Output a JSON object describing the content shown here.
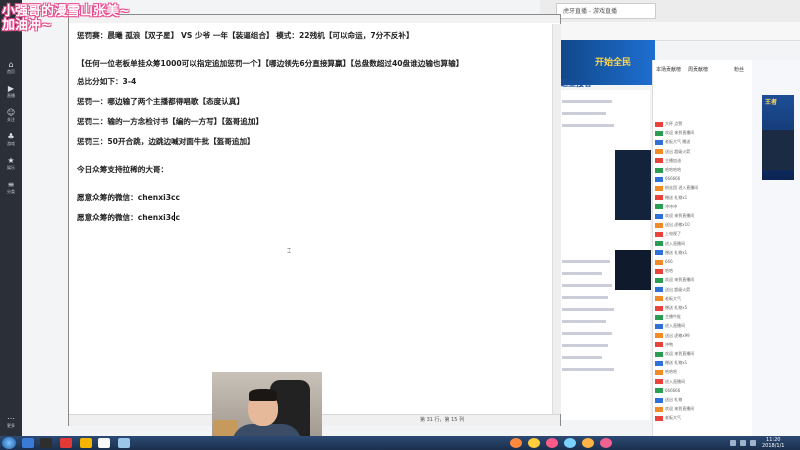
{
  "overlay": {
    "line1": "小强哥的漫雪山张美~",
    "line2": "加油冲~"
  },
  "sidebar": {
    "items": [
      {
        "icon": "home-icon",
        "label": "首页"
      },
      {
        "icon": "play-icon",
        "label": "直播"
      },
      {
        "icon": "user-icon",
        "label": "关注"
      },
      {
        "icon": "game-icon",
        "label": "游戏"
      },
      {
        "icon": "star-icon",
        "label": "娱乐"
      },
      {
        "icon": "list-icon",
        "label": "分类"
      },
      {
        "icon": "more-icon",
        "label": "更多"
      }
    ]
  },
  "notepad": {
    "lines": [
      "惩罚赛：晨曦 孤浪【双子星】 VS  少爷 一年【装逼组合】  模式：22残机【可以命运，7分不反补】",
      "【任何一位老板单挂众筹1000可以指定追加惩罚一个】【哪边领先6分直接算赢】【总盘数超过40盘谁边输也算输】",
      "总比分如下：3-4",
      "惩罚一：哪边输了两个主播都得唱歌【态度认真】",
      "惩罚二：输的一方念检讨书【编的一方写】【盔哥追加】",
      "惩罚三：50开合跳，边跳边喊对面牛批【盔哥追加】",
      "今日众筹支持拉稀的大哥：",
      "愿意众筹的微信：chenxi3cc",
      "愿意众筹的微信：chenxi3cc"
    ],
    "status": "第 31 行，第 15 列"
  },
  "browser": {
    "tab_title": "虎牙直播 - 游戏直播",
    "banner_text": "开始全民",
    "nav_text": "逛业搜客"
  },
  "chat": {
    "tabs": [
      "本场贡献榜",
      "周贡献榜",
      "粉丝"
    ],
    "messages": [
      "大杯 点赞",
      "欢迎 来到直播间",
      "老板大气 赠送",
      "送出 超级火箭",
      "主播加油",
      "哈哈哈哈",
      "666666",
      "粉丝团 进入直播间",
      "赠送 礼物x1",
      "冲冲冲",
      "欢迎 来到直播间",
      "送出 虎粮x10",
      "上电视了",
      "进入直播间",
      "赠送 礼物x1",
      "666",
      "哈哈",
      "欢迎 来到直播间",
      "送出 超级火箭",
      "老板大气",
      "赠送 礼物x5",
      "主播牛批",
      "进入直播间",
      "送出 虎粮x99",
      "冲鸭",
      "欢迎 来到直播间",
      "赠送 礼物x1",
      "哈哈哈",
      "进入直播间",
      "666666",
      "送出 礼物",
      "欢迎 来到直播间",
      "老板大气"
    ]
  },
  "ad": {
    "text": "王者"
  },
  "taskbar": {
    "clock_time": "11:20",
    "clock_date": "2018/1/1"
  }
}
